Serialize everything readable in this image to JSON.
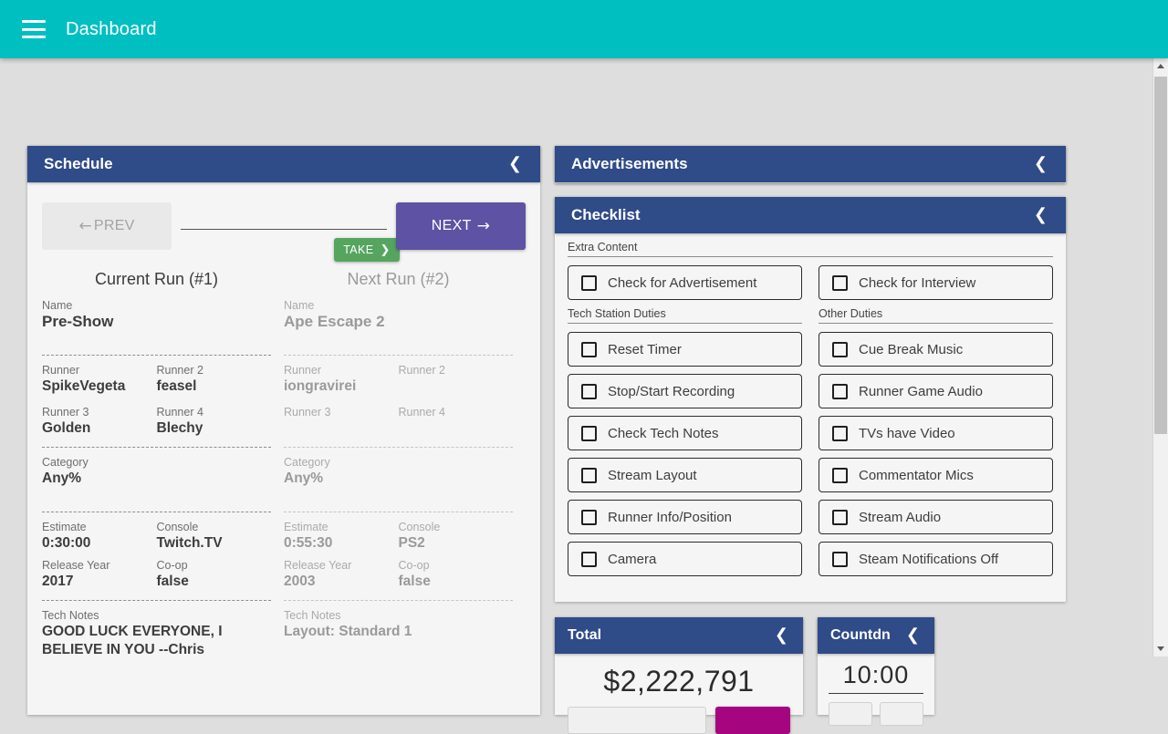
{
  "appbar": {
    "menu_icon": "hamburger-menu-icon",
    "title": "Dashboard",
    "color": "#00bfc1"
  },
  "colors": {
    "panel_header": "#2f4b88",
    "accent_teal": "#00bfc1",
    "next_purple": "#5d52a4",
    "take_green": "#55a55f",
    "donate_magenta": "#a5067f",
    "page_bg": "#dedede"
  },
  "schedule": {
    "title": "Schedule",
    "collapse_icon": "chevron-left-icon",
    "prev_label": "PREV",
    "prev_arrow": "←",
    "next_label": "NEXT",
    "next_arrow": "→",
    "take_label": "TAKE",
    "take_arrow": "❯",
    "current": {
      "heading": "Current Run (#1)",
      "name_label": "Name",
      "name": "Pre-Show",
      "runner_label": "Runner",
      "runner": "SpikeVegeta",
      "runner2_label": "Runner 2",
      "runner2": "feasel",
      "runner3_label": "Runner 3",
      "runner3": "Golden",
      "runner4_label": "Runner 4",
      "runner4": "Blechy",
      "category_label": "Category",
      "category": "Any%",
      "estimate_label": "Estimate",
      "estimate": "0:30:00",
      "console_label": "Console",
      "console": "Twitch.TV",
      "release_label": "Release Year",
      "release": "2017",
      "coop_label": "Co-op",
      "coop": "false",
      "notes_label": "Tech Notes",
      "notes": "GOOD LUCK EVERYONE, I BELIEVE IN YOU --Chris"
    },
    "next": {
      "heading": "Next Run (#2)",
      "name_label": "Name",
      "name": "Ape Escape 2",
      "runner_label": "Runner",
      "runner": "iongravirei",
      "runner2_label": "Runner 2",
      "runner2": "",
      "runner3_label": "Runner 3",
      "runner3": "",
      "runner4_label": "Runner 4",
      "runner4": "",
      "category_label": "Category",
      "category": "Any%",
      "estimate_label": "Estimate",
      "estimate": "0:55:30",
      "console_label": "Console",
      "console": "PS2",
      "release_label": "Release Year",
      "release": "2003",
      "coop_label": "Co-op",
      "coop": "false",
      "notes_label": "Tech Notes",
      "notes": "Layout: Standard 1"
    }
  },
  "advertisements": {
    "title": "Advertisements",
    "collapse_icon": "chevron-left-icon"
  },
  "checklist": {
    "title": "Checklist",
    "collapse_icon": "chevron-left-icon",
    "extra_content_label": "Extra Content",
    "tech_station_label": "Tech Station Duties",
    "other_duties_label": "Other Duties",
    "extra": [
      {
        "label": "Check for Advertisement",
        "checked": false
      },
      {
        "label": "Check for Interview",
        "checked": false
      }
    ],
    "tech_station": [
      {
        "label": "Reset Timer",
        "checked": false
      },
      {
        "label": "Stop/Start Recording",
        "checked": false
      },
      {
        "label": "Check Tech Notes",
        "checked": false
      },
      {
        "label": "Stream Layout",
        "checked": false
      },
      {
        "label": "Runner Info/Position",
        "checked": false
      },
      {
        "label": "Camera",
        "checked": false
      }
    ],
    "other": [
      {
        "label": "Cue Break Music",
        "checked": false
      },
      {
        "label": "Runner Game Audio",
        "checked": false
      },
      {
        "label": "TVs have Video",
        "checked": false
      },
      {
        "label": "Commentator Mics",
        "checked": false
      },
      {
        "label": "Stream Audio",
        "checked": false
      },
      {
        "label": "Steam Notifications Off",
        "checked": false
      }
    ]
  },
  "total": {
    "title": "Total",
    "collapse_icon": "chevron-left-icon",
    "amount": "$2,222,791"
  },
  "countdown": {
    "title": "Countdn",
    "collapse_icon": "chevron-left-icon",
    "time": "10:00"
  },
  "scrollbar": {
    "up_icon": "triangle-up-icon",
    "down_icon": "triangle-down-icon",
    "thumb": "scroll-thumb"
  }
}
